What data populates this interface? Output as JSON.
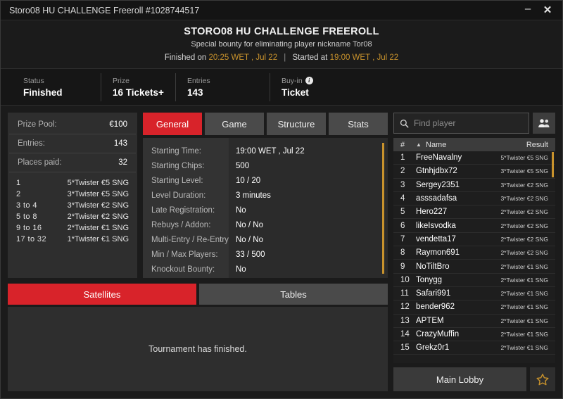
{
  "titlebar": {
    "title": "Storo08 HU CHALLENGE Freeroll #1028744517",
    "minimize": "–",
    "close": "✕"
  },
  "header": {
    "title": "STORO08 HU CHALLENGE FREEROLL",
    "subtitle": "Special bounty for eliminating player nickname Tor08",
    "finished_prefix": "Finished on",
    "finished_time": "20:25 WET , Jul 22",
    "separator": "|",
    "started_prefix": "Started at",
    "started_time": "19:00 WET , Jul 22"
  },
  "status": [
    {
      "label": "Status",
      "value": "Finished",
      "info": false
    },
    {
      "label": "Prize",
      "value": "16 Tickets+",
      "info": false
    },
    {
      "label": "Entries",
      "value": "143",
      "info": false
    },
    {
      "label": "Buy-in",
      "value": "Ticket",
      "info": true,
      "info_glyph": "i"
    }
  ],
  "prize_panel": {
    "rows": [
      {
        "key": "Prize Pool:",
        "value": "€100"
      },
      {
        "key": "Entries:",
        "value": "143"
      },
      {
        "key": "Places paid:",
        "value": "32"
      }
    ],
    "payouts": [
      {
        "rank": "1",
        "prize": "5*Twister €5 SNG"
      },
      {
        "rank": "2",
        "prize": "3*Twister €5 SNG"
      },
      {
        "rank": "3  to  4",
        "prize": "3*Twister €2 SNG"
      },
      {
        "rank": "5  to  8",
        "prize": "2*Twister €2 SNG"
      },
      {
        "rank": "9  to  16",
        "prize": "2*Twister €1 SNG"
      },
      {
        "rank": "17  to  32",
        "prize": "1*Twister €1 SNG"
      }
    ]
  },
  "tabs": [
    {
      "label": "General",
      "active": true
    },
    {
      "label": "Game",
      "active": false
    },
    {
      "label": "Structure",
      "active": false
    },
    {
      "label": "Stats",
      "active": false
    }
  ],
  "general_details": [
    {
      "key": "Starting Time:",
      "value": "19:00 WET , Jul 22"
    },
    {
      "key": "Starting Chips:",
      "value": "500"
    },
    {
      "key": "Starting Level:",
      "value": "10 / 20"
    },
    {
      "key": "Level Duration:",
      "value": "3 minutes"
    },
    {
      "key": "Late Registration:",
      "value": "No"
    },
    {
      "key": "Rebuys / Addon:",
      "value": "No / No"
    },
    {
      "key": "Multi-Entry / Re-Entry:",
      "value": "No / No"
    },
    {
      "key": "Min / Max Players:",
      "value": "33 / 500"
    },
    {
      "key": "Knockout Bounty:",
      "value": "No"
    }
  ],
  "subtabs": [
    {
      "label": "Satellites",
      "active": true
    },
    {
      "label": "Tables",
      "active": false
    }
  ],
  "lower_message": "Tournament has finished.",
  "search": {
    "placeholder": "Find player",
    "value": "",
    "icon": "search-icon",
    "people_icon": "people-icon"
  },
  "player_table": {
    "headers": {
      "num": "#",
      "sort": "▲",
      "name": "Name",
      "result": "Result"
    },
    "rows": [
      {
        "num": "1",
        "name": "FreeNavalny",
        "result": "5*Twister €5 SNG"
      },
      {
        "num": "2",
        "name": "Gtnhjdbx72",
        "result": "3*Twister €5 SNG"
      },
      {
        "num": "3",
        "name": "Sergey2351",
        "result": "3*Twister €2 SNG"
      },
      {
        "num": "4",
        "name": "asssadafsa",
        "result": "3*Twister €2 SNG"
      },
      {
        "num": "5",
        "name": "Hero227",
        "result": "2*Twister €2 SNG"
      },
      {
        "num": "6",
        "name": "likeIsvodka",
        "result": "2*Twister €2 SNG"
      },
      {
        "num": "7",
        "name": "vendetta17",
        "result": "2*Twister €2 SNG"
      },
      {
        "num": "8",
        "name": "Raymon691",
        "result": "2*Twister €2 SNG"
      },
      {
        "num": "9",
        "name": "NoTiltBro",
        "result": "2*Twister €1 SNG"
      },
      {
        "num": "10",
        "name": "Tonygg",
        "result": "2*Twister €1 SNG"
      },
      {
        "num": "11",
        "name": "Safari991",
        "result": "2*Twister €1 SNG"
      },
      {
        "num": "12",
        "name": "bender962",
        "result": "2*Twister €1 SNG"
      },
      {
        "num": "13",
        "name": "APTEM",
        "result": "2*Twister €1 SNG"
      },
      {
        "num": "14",
        "name": "CrazyMuffin",
        "result": "2*Twister €1 SNG"
      },
      {
        "num": "15",
        "name": "Grekz0r1",
        "result": "2*Twister €1 SNG"
      }
    ]
  },
  "footer": {
    "main_lobby": "Main Lobby",
    "favorite_icon": "star-icon"
  },
  "colors": {
    "accent_red": "#d8232a",
    "gold": "#c8922c",
    "window_bg": "#1b1b1b",
    "panel_bg": "#2e2e2e",
    "tab_inactive": "#4a4a4a"
  }
}
